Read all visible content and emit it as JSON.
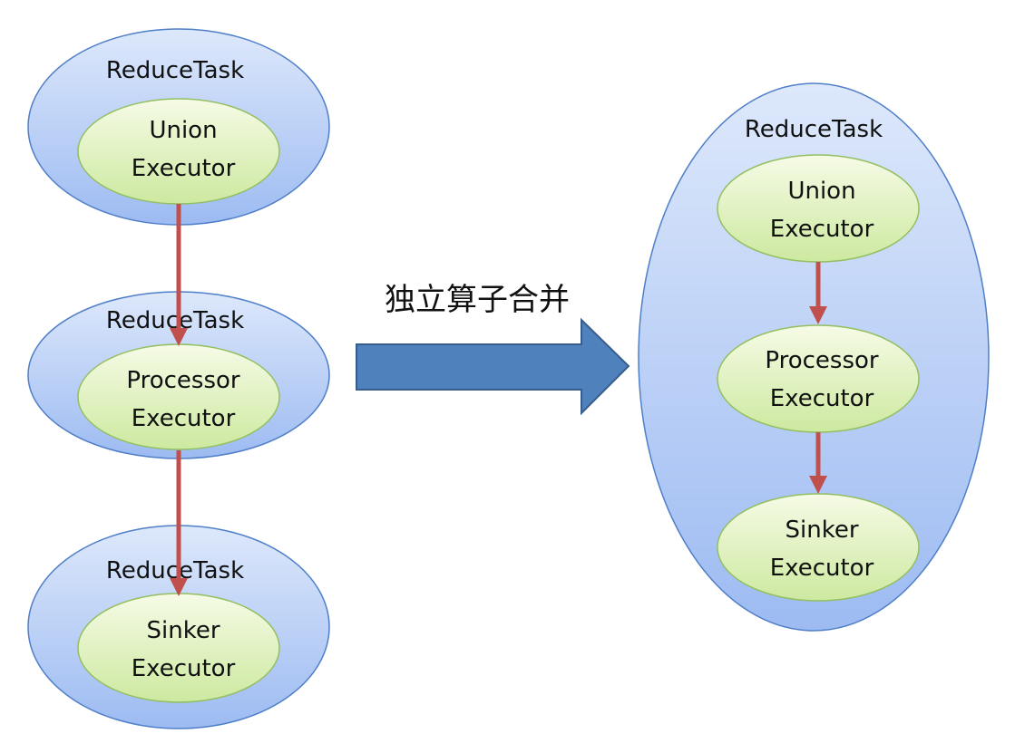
{
  "colors": {
    "task_fill_top": "#dde8fb",
    "task_fill_bottom": "#9dbbf2",
    "task_stroke": "#4f7fc8",
    "executor_fill_top": "#f6fbe6",
    "executor_fill_bottom": "#cde9a0",
    "executor_stroke": "#93bf61",
    "edge": "#c0504d",
    "big_arrow_fill": "#4f81bd",
    "big_arrow_stroke": "#385d8a"
  },
  "left_pipeline": {
    "tasks": [
      {
        "title": "ReduceTask",
        "executor_line1": "Union",
        "executor_line2": "Executor"
      },
      {
        "title": "ReduceTask",
        "executor_line1": "Processor",
        "executor_line2": "Executor"
      },
      {
        "title": "ReduceTask",
        "executor_line1": "Sinker",
        "executor_line2": "Executor"
      }
    ]
  },
  "transform": {
    "label": "独立算子合并",
    "arrow_icon": "right-arrow-icon"
  },
  "merged_task": {
    "title": "ReduceTask",
    "executors": [
      {
        "line1": "Union",
        "line2": "Executor"
      },
      {
        "line1": "Processor",
        "line2": "Executor"
      },
      {
        "line1": "Sinker",
        "line2": "Executor"
      }
    ]
  }
}
